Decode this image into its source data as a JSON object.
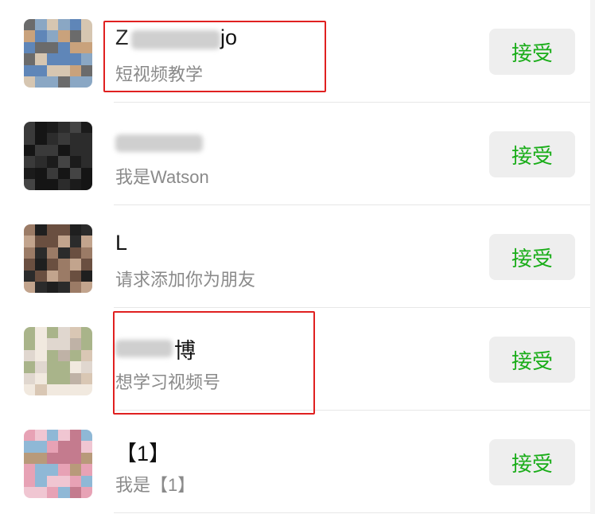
{
  "requests": [
    {
      "name": "Z…johjo",
      "name_visible_fragments": [
        "Z",
        "jo"
      ],
      "message": "短视频教学",
      "button": "接受",
      "avatar_palette": [
        "#5f86b8",
        "#c9a27c",
        "#8aa7c4",
        "#6b6b6b",
        "#d6c6b1"
      ]
    },
    {
      "name": "",
      "message": "我是Watson",
      "button": "接受",
      "avatar_palette": [
        "#1b1b1b",
        "#2c2c2c",
        "#3a3a3a",
        "#151515",
        "#444444"
      ]
    },
    {
      "name": "L",
      "message": "请求添加你为朋友",
      "button": "接受",
      "avatar_palette": [
        "#2b2b2b",
        "#6a4f40",
        "#9b7b66",
        "#1f1f1f",
        "#c2a48d"
      ]
    },
    {
      "name": "…博",
      "name_suffix": "博",
      "message": "想学习视频号",
      "button": "接受",
      "avatar_palette": [
        "#e0d7cf",
        "#a9b48a",
        "#d9c7b4",
        "#bfb2a6",
        "#f1e9df"
      ]
    },
    {
      "name": "【1】",
      "message": "我是【1】",
      "button": "接受",
      "avatar_palette": [
        "#e7a2b5",
        "#c47b8e",
        "#8fb8d6",
        "#b89a7a",
        "#f0c6d2"
      ]
    }
  ],
  "colors": {
    "accept_text": "#1aad19",
    "accept_bg": "#eeeeee",
    "highlight_box": "#e02020",
    "secondary_text": "#8a8a8a"
  }
}
